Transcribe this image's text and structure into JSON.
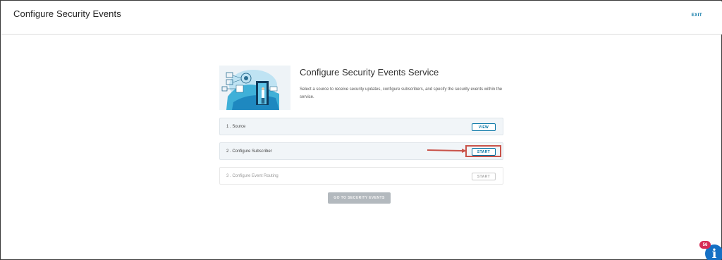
{
  "header": {
    "title": "Configure Security Events",
    "exit_label": "EXIT"
  },
  "hero": {
    "title": "Configure Security Events Service",
    "description": "Select a source to receive security updates, configure subscribers, and specify the security events within the service."
  },
  "steps": [
    {
      "label": "1 . Source",
      "button": "VIEW",
      "enabled": true
    },
    {
      "label": "2 . Configure Subscriber",
      "button": "START",
      "enabled": true
    },
    {
      "label": "3 . Configure Event Routing",
      "button": "START",
      "enabled": false
    }
  ],
  "footer": {
    "goto_label": "GO TO SECURITY EVENTS"
  },
  "info_widget": {
    "badge_count": "56",
    "icon": "info-icon"
  },
  "colors": {
    "accent": "#0072a3",
    "highlight": "#c9534a",
    "badge": "#d62b55",
    "fab": "#1570c4"
  }
}
